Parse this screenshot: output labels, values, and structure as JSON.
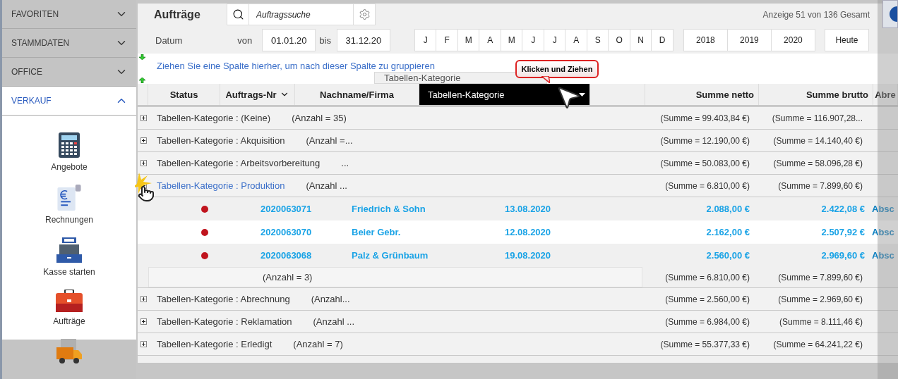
{
  "sidebar": {
    "sections": [
      {
        "label": "FAVORITEN",
        "expanded": false
      },
      {
        "label": "STAMMDATEN",
        "expanded": false
      },
      {
        "label": "OFFICE",
        "expanded": false
      },
      {
        "label": "VERKAUF",
        "expanded": true,
        "items": [
          {
            "kind": "calculator",
            "label": "Angebote"
          },
          {
            "kind": "invoice",
            "label": "Rechnungen"
          },
          {
            "kind": "register",
            "label": "Kasse starten"
          },
          {
            "kind": "briefcase",
            "label": "Aufträge"
          },
          {
            "kind": "truck"
          }
        ]
      }
    ]
  },
  "toolbar": {
    "title": "Aufträge",
    "search": {
      "placeholder": "Auftragssuche"
    },
    "record_count": "Anzeige 51 von 136 Gesamt"
  },
  "date_filter": {
    "label": "Datum",
    "from_label": "von",
    "from": "01.01.20",
    "to_label": "bis",
    "to": "31.12.20",
    "months": [
      "J",
      "F",
      "M",
      "A",
      "M",
      "J",
      "J",
      "A",
      "S",
      "O",
      "N",
      "D"
    ],
    "years": [
      "2018",
      "2019",
      "2020"
    ],
    "today_button": "Heute"
  },
  "group_panel": {
    "hint": "Ziehen Sie eine Spalte hierher, um nach dieser Spalte zu gruppieren",
    "drag_ghost": "Tabellen-Kategorie",
    "tooltip": "Klicken und Ziehen"
  },
  "table": {
    "columns": [
      {
        "label": "Status",
        "kind": "plain"
      },
      {
        "label": "Auftrags-Nr",
        "kind": "filter"
      },
      {
        "label": "Nachname/Firma",
        "kind": "plain"
      },
      {
        "label": "Tabellen-Kategorie",
        "kind": "dragged"
      },
      {
        "kind": "blank"
      },
      {
        "label": "Summe netto",
        "kind": "numeric"
      },
      {
        "label": "Summe brutto",
        "kind": "numeric"
      },
      {
        "label": "Abre",
        "kind": "plain"
      }
    ],
    "groups": [
      {
        "label": "Tabellen-Kategorie : (Keine)",
        "count": "(Anzahl = 35)",
        "netto": "(Summe = 99.403,84 €)",
        "brutto": "(Summe = 116.907,28...",
        "expanded": false
      },
      {
        "label": "Tabellen-Kategorie : Akquisition",
        "count": "(Anzahl =...",
        "netto": "(Summe = 12.190,00 €)",
        "brutto": "(Summe = 14.140,40 €)",
        "expanded": false
      },
      {
        "label": "Tabellen-Kategorie : Arbeitsvorbereitung",
        "count": "...",
        "netto": "(Summe = 50.083,00 €)",
        "brutto": "(Summe = 58.096,28 €)",
        "expanded": false
      },
      {
        "label": "Tabellen-Kategorie : Produktion",
        "count": "(Anzahl ...",
        "netto": "(Summe = 6.810,00 €)",
        "brutto": "(Summe = 7.899,60 €)",
        "expanded": true,
        "rows": [
          {
            "order_no": "2020063071",
            "name": "Friedrich & Sohn",
            "date": "13.08.2020",
            "netto": "2.088,00 €",
            "brutto": "2.422,08 €",
            "column_8": "Absc"
          },
          {
            "order_no": "2020063070",
            "name": "Beier Gebr.",
            "date": "12.08.2020",
            "netto": "2.162,00 €",
            "brutto": "2.507,92 €",
            "column_8": "Absc"
          },
          {
            "order_no": "2020063068",
            "name": "Palz & Grünbaum",
            "date": "19.08.2020",
            "netto": "2.560,00 €",
            "brutto": "2.969,60 €",
            "column_8": "Absc"
          }
        ],
        "footer": {
          "count": "(Anzahl = 3)",
          "netto": "(Summe = 6.810,00 €)",
          "brutto": "(Summe = 7.899,60 €)"
        }
      },
      {
        "label": "Tabellen-Kategorie : Abrechnung",
        "count": "(Anzahl...",
        "netto": "(Summe = 2.560,00 €)",
        "brutto": "(Summe = 2.969,60 €)",
        "expanded": false
      },
      {
        "label": "Tabellen-Kategorie : Reklamation",
        "count": "(Anzahl ...",
        "netto": "(Summe = 6.984,00 €)",
        "brutto": "(Summe = 8.111,46 €)",
        "expanded": false
      },
      {
        "label": "Tabellen-Kategorie : Erledigt",
        "count": "(Anzahl = 7)",
        "netto": "(Summe = 55.377,33 €)",
        "brutto": "(Summe = 64.241,22 €)",
        "expanded": false
      }
    ]
  }
}
